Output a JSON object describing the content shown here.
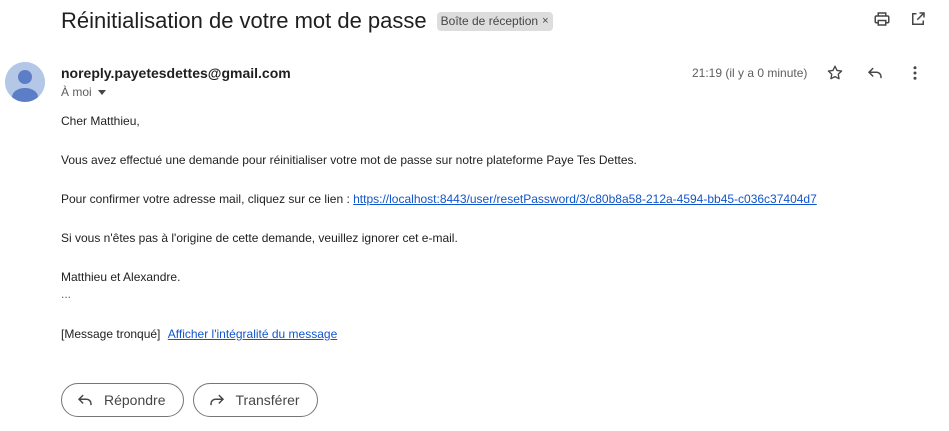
{
  "header": {
    "subject": "Réinitialisation de votre mot de passe",
    "label": "Boîte de réception",
    "label_remove": "×",
    "icons": [
      "print-icon",
      "open-in-new-window-icon"
    ]
  },
  "message": {
    "sender": "noreply.payetesdettes@gmail.com",
    "recipient": "À moi",
    "timestamp": "21:19 (il y a 0 minute)",
    "action_icons": [
      "star-icon",
      "reply-icon",
      "more-options-icon"
    ],
    "body": {
      "greeting": "Cher Matthieu,",
      "line1": "Vous avez effectué une demande pour réinitialiser votre mot de passe sur notre plateforme Paye Tes Dettes.",
      "line2_prefix": "Pour confirmer votre adresse mail, cliquez sur ce lien :",
      "reset_link": "https://localhost:8443/user/resetPassword/3/c80b8a58-212a-4594-bb45-c036c37404d7",
      "line3": "Si vous n'êtes pas à l'origine de cette demande, veuillez ignorer cet e-mail.",
      "signature": "Matthieu et Alexandre.",
      "ellipsis": "..."
    },
    "truncated_note": "[Message tronqué]",
    "show_full_link": "Afficher l'intégralité du message"
  },
  "actions": {
    "reply_label": "Répondre",
    "forward_label": "Transférer"
  },
  "colors": {
    "link": "#1155cc",
    "avatar_bg": "#b4c7e7",
    "avatar_fg": "#5b7ec6",
    "chip_bg": "#dddddd"
  }
}
